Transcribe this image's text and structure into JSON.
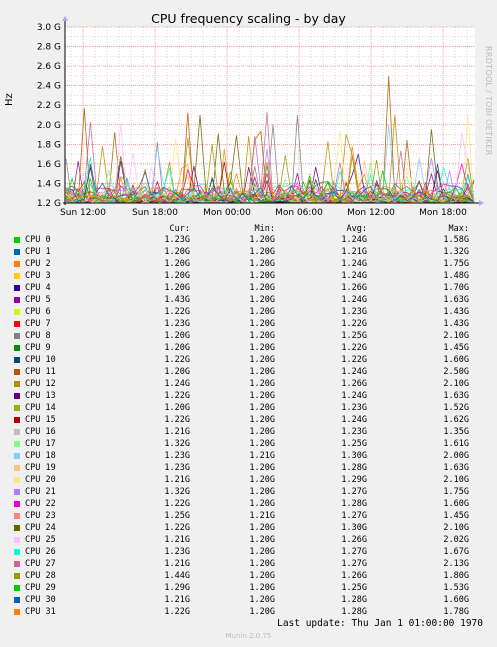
{
  "title": "CPU frequency scaling - by day",
  "side_label": "RRDTOOL / TOBI OETIKER",
  "chart_data": {
    "type": "line",
    "title": "CPU frequency scaling - by day",
    "ylabel": "Hz",
    "xlabel": "",
    "ylim": [
      1.2,
      3.0
    ],
    "yticks": [
      "1.2 G",
      "1.4 G",
      "1.6 G",
      "1.8 G",
      "2.0 G",
      "2.2 G",
      "2.4 G",
      "2.6 G",
      "2.8 G",
      "3.0 G"
    ],
    "xticks": [
      "Sun 12:00",
      "Sun 18:00",
      "Mon 00:00",
      "Mon 06:00",
      "Mon 12:00",
      "Mon 18:00"
    ],
    "grid": true,
    "legend_columns": [
      "Cur:",
      "Min:",
      "Avg:",
      "Max:"
    ],
    "series": [
      {
        "name": "CPU 0",
        "color": "#00cc00",
        "cur": "1.23G",
        "min": "1.20G",
        "avg": "1.24G",
        "max": "1.58G"
      },
      {
        "name": "CPU 1",
        "color": "#0066b3",
        "cur": "1.20G",
        "min": "1.20G",
        "avg": "1.21G",
        "max": "1.32G"
      },
      {
        "name": "CPU 2",
        "color": "#ff8000",
        "cur": "1.20G",
        "min": "1.20G",
        "avg": "1.24G",
        "max": "1.75G"
      },
      {
        "name": "CPU 3",
        "color": "#ffcc00",
        "cur": "1.20G",
        "min": "1.20G",
        "avg": "1.24G",
        "max": "1.48G"
      },
      {
        "name": "CPU 4",
        "color": "#330099",
        "cur": "1.20G",
        "min": "1.20G",
        "avg": "1.26G",
        "max": "1.70G"
      },
      {
        "name": "CPU 5",
        "color": "#990099",
        "cur": "1.43G",
        "min": "1.20G",
        "avg": "1.24G",
        "max": "1.63G"
      },
      {
        "name": "CPU 6",
        "color": "#ccff00",
        "cur": "1.22G",
        "min": "1.20G",
        "avg": "1.23G",
        "max": "1.43G"
      },
      {
        "name": "CPU 7",
        "color": "#ff0000",
        "cur": "1.23G",
        "min": "1.20G",
        "avg": "1.22G",
        "max": "1.43G"
      },
      {
        "name": "CPU 8",
        "color": "#808080",
        "cur": "1.20G",
        "min": "1.20G",
        "avg": "1.25G",
        "max": "2.10G"
      },
      {
        "name": "CPU 9",
        "color": "#008f00",
        "cur": "1.20G",
        "min": "1.20G",
        "avg": "1.22G",
        "max": "1.45G"
      },
      {
        "name": "CPU 10",
        "color": "#00487d",
        "cur": "1.22G",
        "min": "1.20G",
        "avg": "1.22G",
        "max": "1.60G"
      },
      {
        "name": "CPU 11",
        "color": "#b35a00",
        "cur": "1.20G",
        "min": "1.20G",
        "avg": "1.24G",
        "max": "2.50G"
      },
      {
        "name": "CPU 12",
        "color": "#b38f00",
        "cur": "1.24G",
        "min": "1.20G",
        "avg": "1.26G",
        "max": "2.10G"
      },
      {
        "name": "CPU 13",
        "color": "#6b006b",
        "cur": "1.22G",
        "min": "1.20G",
        "avg": "1.24G",
        "max": "1.63G"
      },
      {
        "name": "CPU 14",
        "color": "#8fb300",
        "cur": "1.20G",
        "min": "1.20G",
        "avg": "1.23G",
        "max": "1.52G"
      },
      {
        "name": "CPU 15",
        "color": "#b30000",
        "cur": "1.22G",
        "min": "1.20G",
        "avg": "1.24G",
        "max": "1.62G"
      },
      {
        "name": "CPU 16",
        "color": "#bebebe",
        "cur": "1.21G",
        "min": "1.20G",
        "avg": "1.23G",
        "max": "1.35G"
      },
      {
        "name": "CPU 17",
        "color": "#80ff80",
        "cur": "1.32G",
        "min": "1.20G",
        "avg": "1.25G",
        "max": "1.61G"
      },
      {
        "name": "CPU 18",
        "color": "#80c9ff",
        "cur": "1.23G",
        "min": "1.21G",
        "avg": "1.30G",
        "max": "2.00G"
      },
      {
        "name": "CPU 19",
        "color": "#ffc080",
        "cur": "1.23G",
        "min": "1.20G",
        "avg": "1.28G",
        "max": "1.63G"
      },
      {
        "name": "CPU 20",
        "color": "#ffe680",
        "cur": "1.21G",
        "min": "1.20G",
        "avg": "1.29G",
        "max": "2.10G"
      },
      {
        "name": "CPU 21",
        "color": "#aa80ff",
        "cur": "1.32G",
        "min": "1.20G",
        "avg": "1.27G",
        "max": "1.75G"
      },
      {
        "name": "CPU 22",
        "color": "#ee00cc",
        "cur": "1.22G",
        "min": "1.20G",
        "avg": "1.28G",
        "max": "1.60G"
      },
      {
        "name": "CPU 23",
        "color": "#ff8080",
        "cur": "1.25G",
        "min": "1.21G",
        "avg": "1.27G",
        "max": "1.45G"
      },
      {
        "name": "CPU 24",
        "color": "#666600",
        "cur": "1.22G",
        "min": "1.20G",
        "avg": "1.30G",
        "max": "2.10G"
      },
      {
        "name": "CPU 25",
        "color": "#ffbfff",
        "cur": "1.21G",
        "min": "1.20G",
        "avg": "1.26G",
        "max": "2.02G"
      },
      {
        "name": "CPU 26",
        "color": "#00ffcc",
        "cur": "1.23G",
        "min": "1.20G",
        "avg": "1.27G",
        "max": "1.67G"
      },
      {
        "name": "CPU 27",
        "color": "#cc6699",
        "cur": "1.21G",
        "min": "1.20G",
        "avg": "1.27G",
        "max": "2.13G"
      },
      {
        "name": "CPU 28",
        "color": "#999900",
        "cur": "1.44G",
        "min": "1.20G",
        "avg": "1.26G",
        "max": "1.80G"
      },
      {
        "name": "CPU 29",
        "color": "#00cc00",
        "cur": "1.29G",
        "min": "1.20G",
        "avg": "1.25G",
        "max": "1.53G"
      },
      {
        "name": "CPU 30",
        "color": "#0066b3",
        "cur": "1.21G",
        "min": "1.20G",
        "avg": "1.28G",
        "max": "1.60G"
      },
      {
        "name": "CPU 31",
        "color": "#ff8000",
        "cur": "1.22G",
        "min": "1.20G",
        "avg": "1.28G",
        "max": "1.78G"
      }
    ]
  },
  "last_update": "Last update:  Thu Jan  1 01:00:00 1970",
  "footer": "Munin 2.0.75"
}
